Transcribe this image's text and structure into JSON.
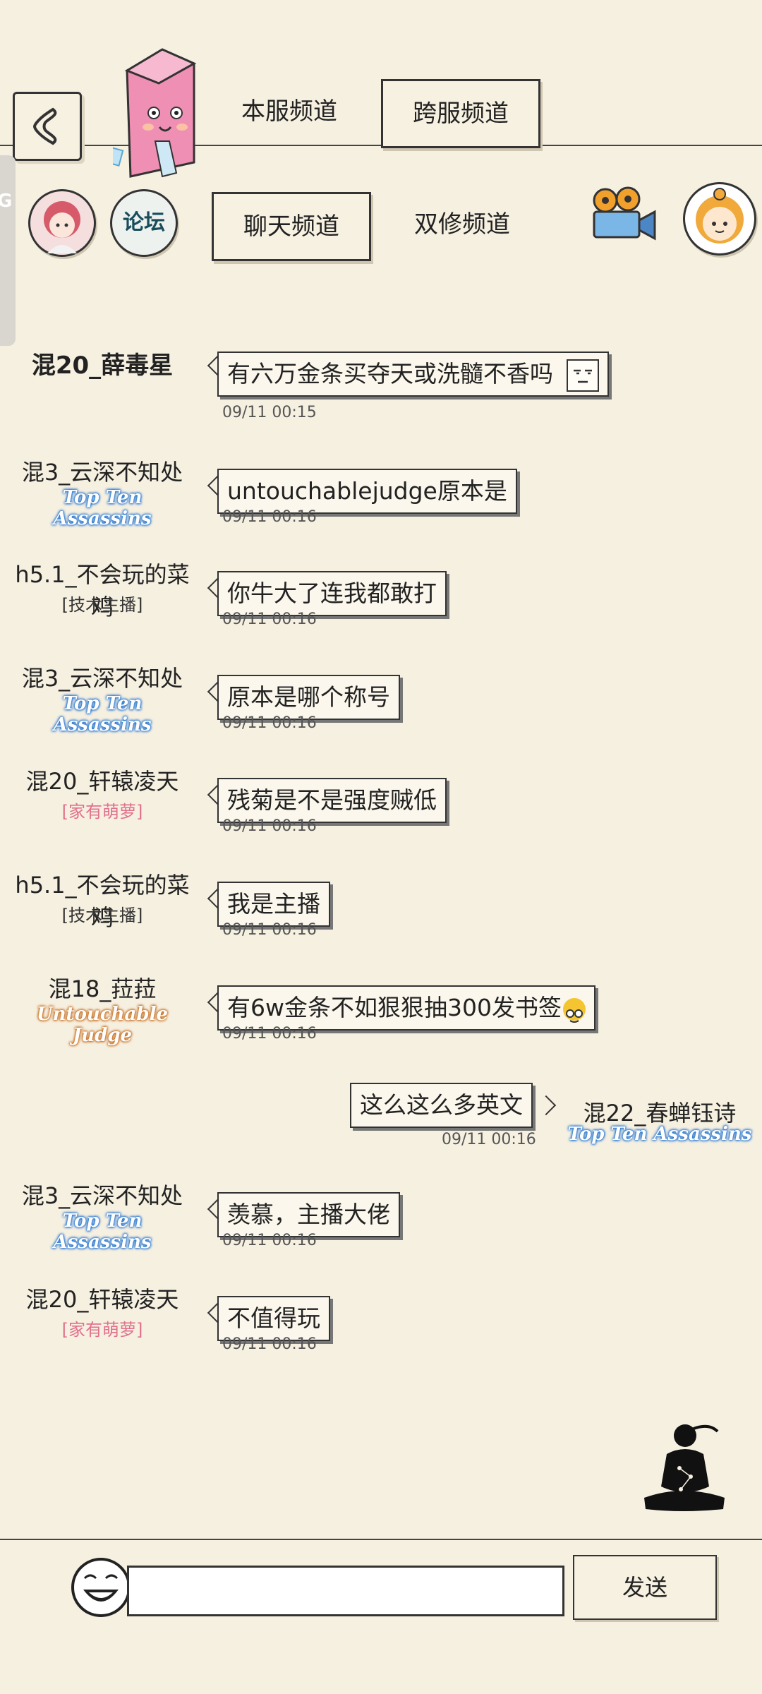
{
  "header": {
    "tabs_top": [
      {
        "label": "本服频道",
        "active": false
      },
      {
        "label": "跨服频道",
        "active": true
      }
    ],
    "tabs_bottom": [
      {
        "label": "聊天频道",
        "active": true
      },
      {
        "label": "双修频道",
        "active": false
      }
    ],
    "forum_label": "论坛",
    "side_tag": "G"
  },
  "messages": [
    {
      "name": "混20_薛毒星",
      "badge": "",
      "text": "有六万金条买夺天或洗髓不香吗",
      "time": "09/11 00:15"
    },
    {
      "name": "混3_云深不知处",
      "badge": "Top Ten Assassins",
      "text": "untouchablejudge原本是",
      "time": "09/11 00:16"
    },
    {
      "name": "h5.1_不会玩的菜鸡",
      "badge": "[技术主播]",
      "text": "你牛大了连我都敢打",
      "time": "09/11 00:16"
    },
    {
      "name": "混3_云深不知处",
      "badge": "Top Ten Assassins",
      "text": "原本是哪个称号",
      "time": "09/11 00:16"
    },
    {
      "name": "混20_轩辕凌天",
      "badge": "[家有萌萝]",
      "text": "残菊是不是强度贼低",
      "time": "09/11 00:16"
    },
    {
      "name": "h5.1_不会玩的菜鸡",
      "badge": "[技术主播]",
      "text": "我是主播",
      "time": "09/11 00:16"
    },
    {
      "name": "混18_菈菈",
      "badge": "Untouchable Judge",
      "text": "有6w金条不如狠狠抽300发书签",
      "time": "09/11 00:16"
    },
    {
      "name": "混22_春蝉钰诗",
      "badge": "Top Ten Assassins",
      "text": "这么这么多英文",
      "time": "09/11 00:16"
    },
    {
      "name": "混3_云深不知处",
      "badge": "Top Ten Assassins",
      "text": "羡慕，主播大佬",
      "time": "09/11 00:16"
    },
    {
      "name": "混20_轩辕凌天",
      "badge": "[家有萌萝]",
      "text": "不值得玩",
      "time": "09/11 00:16"
    }
  ],
  "composer": {
    "send_label": "发送",
    "input_value": "",
    "placeholder": ""
  },
  "colors": {
    "background": "#f6f0e1",
    "badge_blue": "#1b6fd0",
    "badge_orange": "#c56a1a",
    "badge_pink": "#e0708c"
  }
}
